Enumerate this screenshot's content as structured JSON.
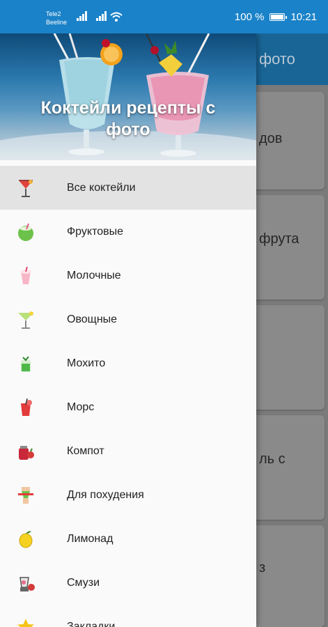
{
  "status_bar": {
    "carrier_1": "Tele2",
    "carrier_2": "Beeline",
    "battery": "100 %",
    "time": "10:21"
  },
  "background_app": {
    "toolbar_title_fragment": "фото",
    "cards": [
      "дов",
      "фрута",
      "ль с",
      "з"
    ]
  },
  "drawer": {
    "header_title_line1": "Коктейли рецепты с",
    "header_title_line2": "фото",
    "items": [
      {
        "label": "Все коктейли",
        "icon": "cocktail-glass-icon"
      },
      {
        "label": "Фруктовые",
        "icon": "coconut-drink-icon"
      },
      {
        "label": "Молочные",
        "icon": "milkshake-icon"
      },
      {
        "label": "Овощные",
        "icon": "martini-glass-icon"
      },
      {
        "label": "Мохито",
        "icon": "mojito-icon"
      },
      {
        "label": "Морс",
        "icon": "juice-glass-icon"
      },
      {
        "label": "Компот",
        "icon": "compote-jar-icon"
      },
      {
        "label": "Для похудения",
        "icon": "slim-body-icon"
      },
      {
        "label": "Лимонад",
        "icon": "lemon-icon"
      },
      {
        "label": "Смузи",
        "icon": "blender-icon"
      },
      {
        "label": "Закладки",
        "icon": "star-icon"
      }
    ]
  },
  "colors": {
    "status_bar": "#1a82c8",
    "toolbar": "#196596",
    "drawer_bg": "#fafafa",
    "active_item": "#e3e3e3"
  }
}
